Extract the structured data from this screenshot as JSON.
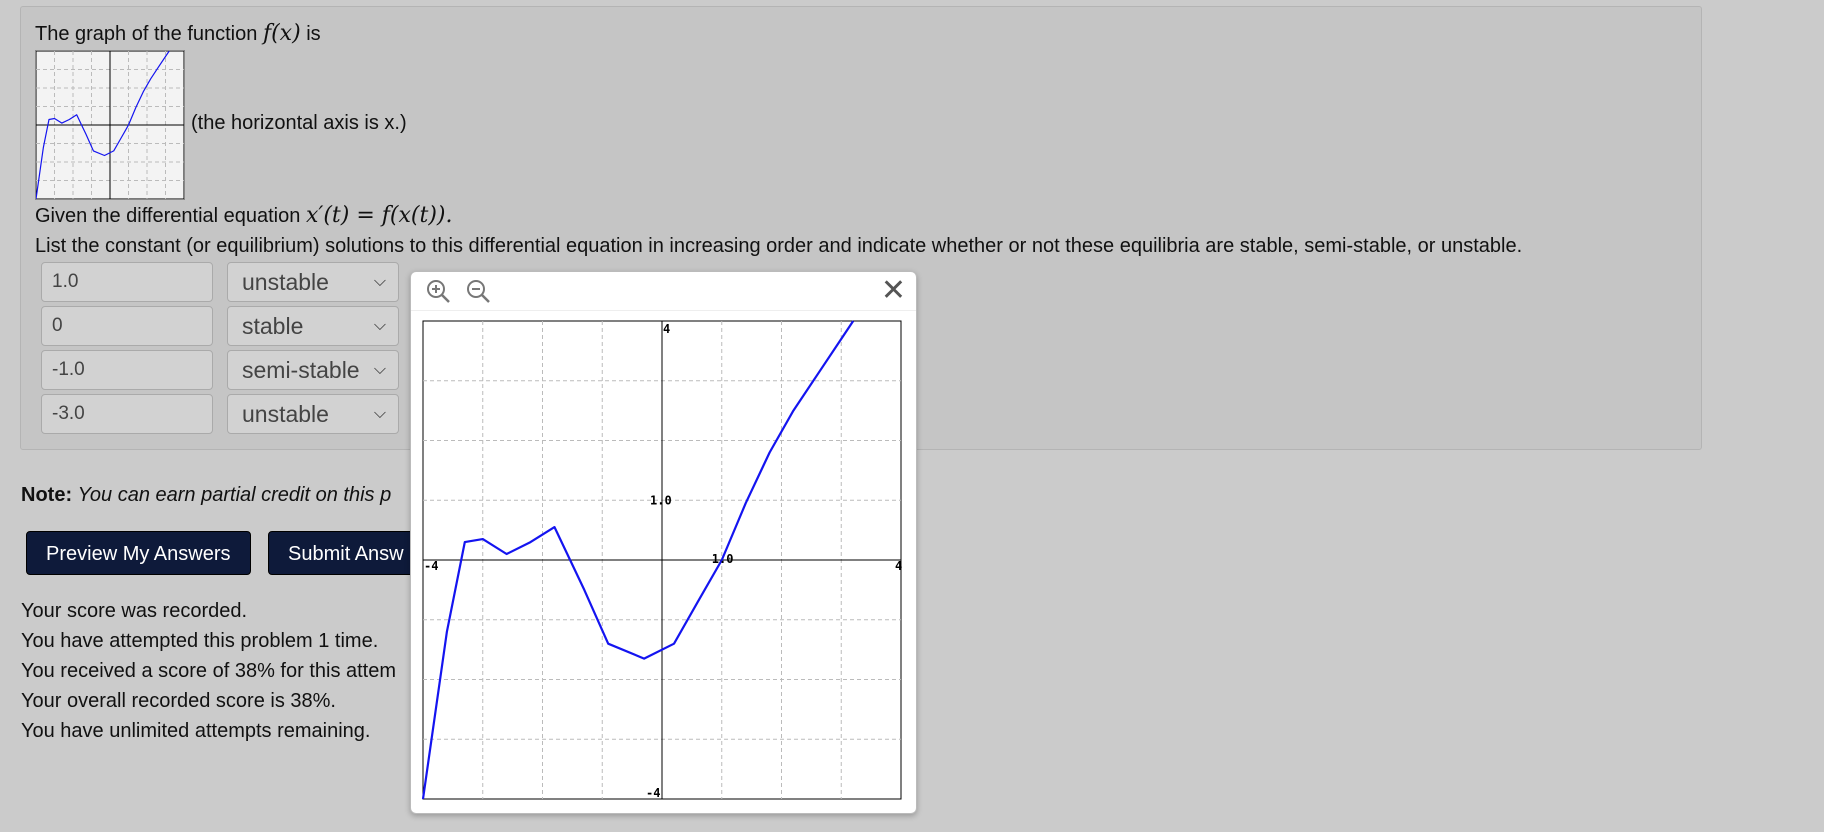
{
  "problem": {
    "intro_text": "The graph of the function",
    "intro_math": "f(x)",
    "intro_tail": "is",
    "axis_note": "(the horizontal axis is x.)",
    "given_text": "Given the differential equation",
    "given_math": "x′(t) = f(x(t)).",
    "instructions": "List the constant (or equilibrium) solutions to this differential equation in increasing order and indicate whether or not these equilibria are stable, semi-stable, or unstable.",
    "answers": [
      {
        "value": "1.0",
        "stability": "unstable"
      },
      {
        "value": "0",
        "stability": "stable"
      },
      {
        "value": "-1.0",
        "stability": "semi-stable"
      },
      {
        "value": "-3.0",
        "stability": "unstable"
      }
    ]
  },
  "note": {
    "label": "Note:",
    "text": "You can earn partial credit on this p"
  },
  "buttons": {
    "preview": "Preview My Answers",
    "submit": "Submit Answ"
  },
  "status": [
    "Your score was recorded.",
    "You have attempted this problem 1 time.",
    "You received a score of 38% for this attem",
    "Your overall recorded score is 38%.",
    "You have unlimited attempts remaining."
  ],
  "popup": {
    "close_glyph": "✕",
    "icons": {
      "zoom_in": "zoom-in-icon",
      "zoom_out": "zoom-out-icon",
      "close": "close-icon"
    }
  },
  "graph": {
    "xlim": [
      -4,
      4
    ],
    "ylim": [
      -4,
      4
    ],
    "grid": true,
    "curve_color": "#1414f0",
    "tick_labels": {
      "x_min": "-4",
      "x_max": "4",
      "x_one": "1.0",
      "y_max": "4",
      "y_min": "-4",
      "y_one": "1.0"
    },
    "curve": [
      [
        -4.0,
        -4.0
      ],
      [
        -3.6,
        -1.2
      ],
      [
        -3.3,
        0.3
      ],
      [
        -3.0,
        0.35
      ],
      [
        -2.6,
        0.1
      ],
      [
        -2.2,
        0.3
      ],
      [
        -1.8,
        0.55
      ],
      [
        -1.3,
        -0.5
      ],
      [
        -0.9,
        -1.4
      ],
      [
        -0.3,
        -1.65
      ],
      [
        0.2,
        -1.4
      ],
      [
        0.6,
        -0.7
      ],
      [
        1.0,
        0.0
      ],
      [
        1.4,
        0.95
      ],
      [
        1.8,
        1.8
      ],
      [
        2.2,
        2.5
      ],
      [
        2.6,
        3.1
      ],
      [
        3.0,
        3.7
      ],
      [
        3.2,
        4.0
      ]
    ]
  }
}
